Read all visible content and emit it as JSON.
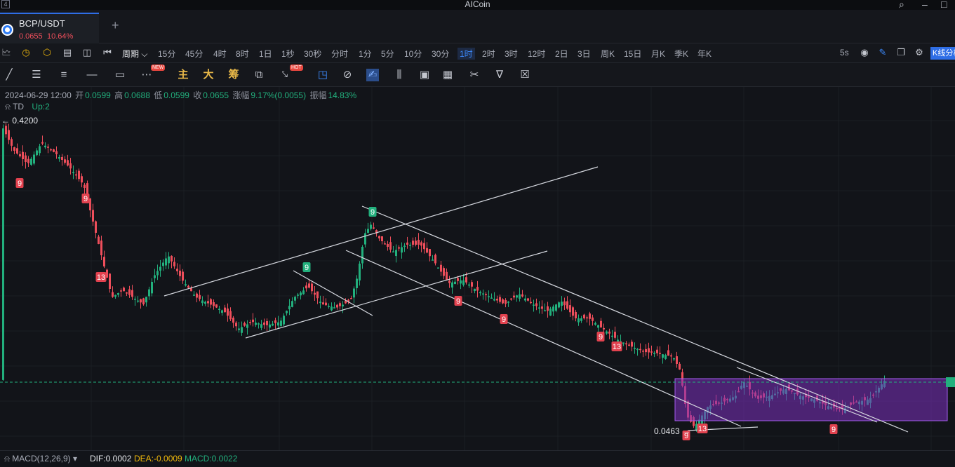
{
  "app": {
    "title": "AICoin",
    "window_number": "4"
  },
  "tabs": [
    {
      "pair": "BCP/USDT",
      "price": "0.0655",
      "change": "10.64%"
    }
  ],
  "period_bar": {
    "current": "周期",
    "items": [
      "15分",
      "45分",
      "4时",
      "8时",
      "1日",
      "1秒",
      "30秒",
      "分时",
      "1分",
      "5分",
      "10分",
      "30分",
      "1时",
      "2时",
      "3时",
      "12时",
      "2日",
      "3日",
      "周K",
      "15日",
      "月K",
      "季K",
      "年K"
    ],
    "active": "1时",
    "refresh": "5s",
    "kline_button": "K线分析"
  },
  "draw_bar": {
    "main_label": "主",
    "big_label": "大",
    "chips_label": "筹",
    "new_badge": "NEW",
    "hot_badge": "HOT"
  },
  "ohlc": {
    "time": "2024-06-29 12:00",
    "open_label": "开",
    "open": "0.0599",
    "high_label": "高",
    "high": "0.0688",
    "low_label": "低",
    "low": "0.0599",
    "close_label": "收",
    "close": "0.0655",
    "change_label": "涨幅",
    "change": "9.17%(0.0055)",
    "amp_label": "振幅",
    "amp": "14.83%"
  },
  "indicator_td": {
    "name": "TD",
    "value": "Up:2"
  },
  "chart_labels": {
    "high_price": "0.4200",
    "low_price": "0.0463",
    "td_marks": [
      "9",
      "9",
      "13",
      "9",
      "9",
      "9",
      "9",
      "13",
      "9",
      "13",
      "9"
    ]
  },
  "macd": {
    "name": "MACD(12,26,9)",
    "dif_label": "DIF:",
    "dif": "0.0002",
    "dea_label": "DEA:",
    "dea": "-0.0009",
    "macd_label": "MACD:",
    "macd": "0.0022"
  },
  "colors": {
    "up": "#22b07d",
    "down": "#ee4e5b",
    "accent": "#2f6ee6",
    "box": "#7b2fbe"
  }
}
